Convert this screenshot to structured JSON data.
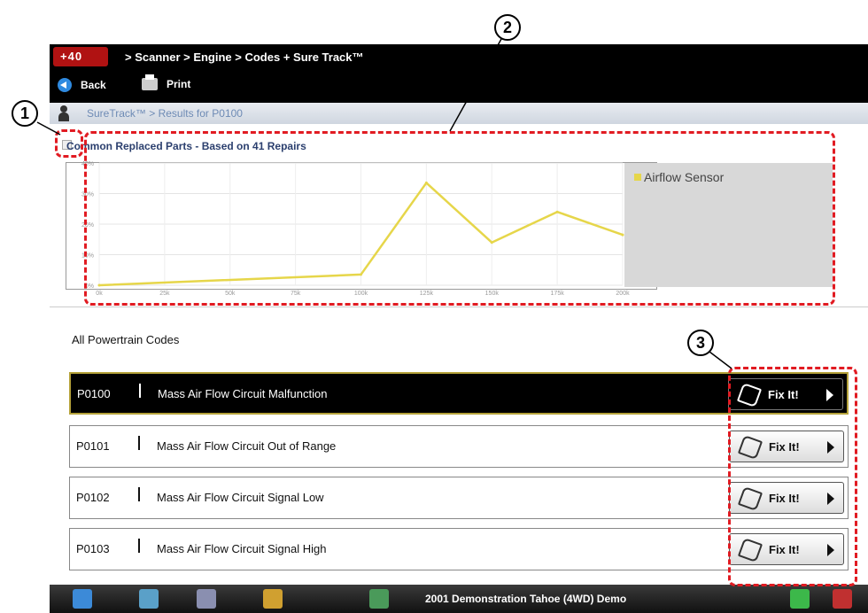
{
  "nav": {
    "logo_text": "+40",
    "breadcrumb": "> Scanner  > Engine  > Codes + Sure Track™"
  },
  "toolbar": {
    "back_label": "Back",
    "print_label": "Print"
  },
  "sub_header": {
    "text": "SureTrack™ > Results for P0100"
  },
  "chart_panel": {
    "title": "Common Replaced Parts - Based on 41 Repairs"
  },
  "chart_data": {
    "type": "line",
    "title": "Common Replaced Parts - Based on 41 Repairs",
    "x_ticks": [
      "0k",
      "25k",
      "50k",
      "75k",
      "100k",
      "125k",
      "150k",
      "175k",
      "200k"
    ],
    "y_ticks": [
      "0%",
      "10%",
      "20%",
      "30%",
      "40%"
    ],
    "ylim": [
      0,
      40
    ],
    "legend_position": "top-right",
    "series": [
      {
        "name": "Airflow Sensor",
        "color": "#e6d64a",
        "x": [
          0,
          100,
          125,
          150,
          175,
          200
        ],
        "y": [
          0,
          3.5,
          33.5,
          14,
          24,
          16.5
        ]
      }
    ]
  },
  "codes_section": {
    "title": "All Powertrain Codes"
  },
  "codes": [
    {
      "code": "P0100",
      "description": "Mass Air Flow Circuit Malfunction",
      "button": "Fix It!",
      "selected": true
    },
    {
      "code": "P0101",
      "description": "Mass Air Flow Circuit Out of Range",
      "button": "Fix It!",
      "selected": false
    },
    {
      "code": "P0102",
      "description": "Mass Air Flow Circuit Signal Low",
      "button": "Fix It!",
      "selected": false
    },
    {
      "code": "P0103",
      "description": "Mass Air Flow Circuit Signal High",
      "button": "Fix It!",
      "selected": false
    }
  ],
  "taskbar": {
    "vehicle": "2001 Demonstration Tahoe (4WD) Demo"
  },
  "callouts": [
    "1",
    "2",
    "3"
  ],
  "colors": {
    "highlight_dash": "#e11b22",
    "series": "#e6d64a",
    "selected_border": "#b5a23a"
  }
}
